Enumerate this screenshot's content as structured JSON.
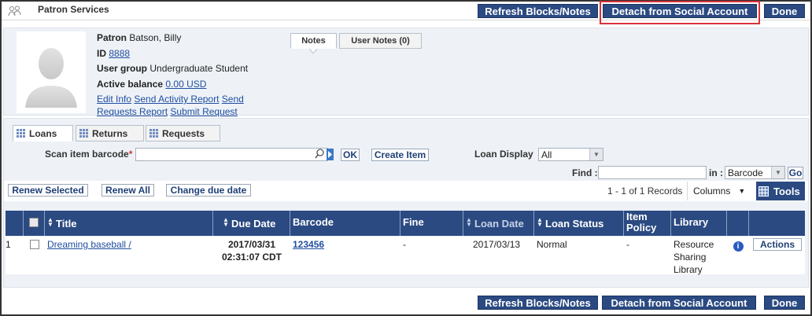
{
  "header": {
    "title": "Patron Services",
    "buttons": {
      "refresh": "Refresh Blocks/Notes",
      "detach": "Detach from Social Account",
      "done": "Done"
    }
  },
  "patron": {
    "name_label": "Patron",
    "name": "Batson, Billy",
    "id_label": "ID",
    "id": "8888",
    "group_label": "User group",
    "group": "Undergraduate Student",
    "balance_label": "Active balance",
    "balance": "0.00 USD",
    "links": {
      "edit": "Edit Info",
      "activity": "Send Activity Report",
      "send": "Send",
      "requests": "Requests Report",
      "submit": "Submit Request"
    }
  },
  "note_tabs": [
    "Notes",
    "User Notes (0)"
  ],
  "main_tabs": [
    "Loans",
    "Returns",
    "Requests"
  ],
  "scan": {
    "label": "Scan item barcode",
    "required": "*",
    "value": "",
    "ok": "OK",
    "create": "Create Item"
  },
  "loan_display": {
    "label": "Loan Display",
    "value": "All"
  },
  "find": {
    "label": "Find :",
    "value": "",
    "in_label": "in :",
    "in_value": "Barcode",
    "go": "Go"
  },
  "toolbar": {
    "renew_selected": "Renew Selected",
    "renew_all": "Renew All",
    "change_due": "Change due date",
    "records": "1 - 1 of 1 Records",
    "columns": "Columns",
    "tools": "Tools"
  },
  "table": {
    "headers": {
      "title": "Title",
      "due": "Due Date",
      "barcode": "Barcode",
      "fine": "Fine",
      "loan_date": "Loan Date",
      "loan_status": "Loan Status",
      "item_policy": "Item Policy",
      "library": "Library"
    },
    "row": {
      "num": "1",
      "title": "Dreaming baseball /",
      "due1": "2017/03/31",
      "due2": "02:31:07 CDT",
      "barcode": "123456",
      "fine": "-",
      "loan_date": "2017/03/13",
      "loan_status": "Normal",
      "item_policy": "-",
      "library1": "Resource",
      "library2": "Sharing",
      "library3": "Library",
      "actions": "Actions"
    }
  },
  "colors": {
    "primary": "#2b4a82",
    "highlight": "#d9323a",
    "link": "#1f4ea0"
  }
}
